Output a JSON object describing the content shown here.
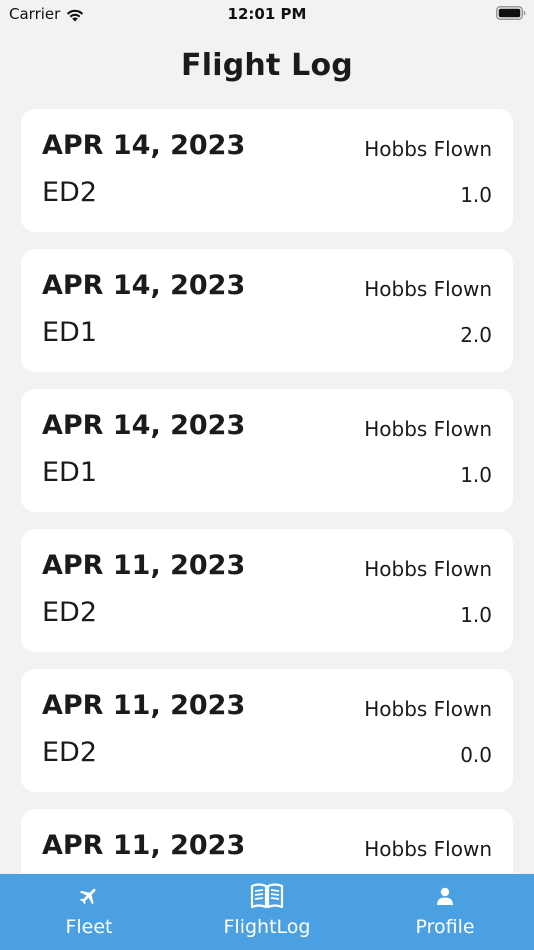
{
  "status_bar": {
    "carrier": "Carrier",
    "time": "12:01 PM"
  },
  "header": {
    "title": "Flight Log"
  },
  "flights": [
    {
      "date": "APR 14, 2023",
      "aircraft": "ED2",
      "label": "Hobbs Flown",
      "hobbs": "1.0"
    },
    {
      "date": "APR 14, 2023",
      "aircraft": "ED1",
      "label": "Hobbs Flown",
      "hobbs": "2.0"
    },
    {
      "date": "APR 14, 2023",
      "aircraft": "ED1",
      "label": "Hobbs Flown",
      "hobbs": "1.0"
    },
    {
      "date": "APR 11, 2023",
      "aircraft": "ED2",
      "label": "Hobbs Flown",
      "hobbs": "1.0"
    },
    {
      "date": "APR 11, 2023",
      "aircraft": "ED2",
      "label": "Hobbs Flown",
      "hobbs": "0.0"
    },
    {
      "date": "APR 11, 2023",
      "aircraft": "",
      "label": "Hobbs Flown",
      "hobbs": ""
    }
  ],
  "tabs": [
    {
      "label": "Fleet",
      "icon": "airplane-icon"
    },
    {
      "label": "FlightLog",
      "icon": "book-icon"
    },
    {
      "label": "Profile",
      "icon": "person-icon"
    }
  ],
  "colors": {
    "background": "#f2f2f2",
    "card": "#ffffff",
    "tab_bar": "#4aa0e0",
    "tab_text": "#ffffff"
  }
}
